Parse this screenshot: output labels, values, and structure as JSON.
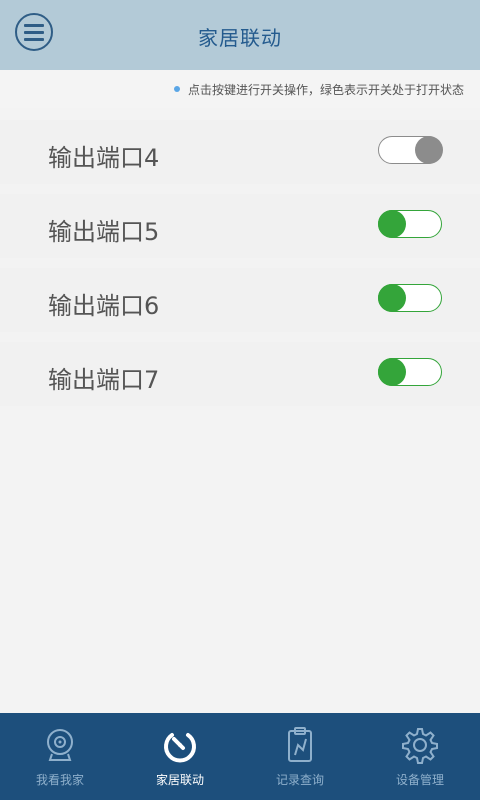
{
  "header": {
    "title": "家居联动",
    "menu_icon": "hamburger-menu-icon"
  },
  "hint": {
    "text": "点击按键进行开关操作，绿色表示开关处于打开状态",
    "dot_color": "#5aa6e6"
  },
  "ports": [
    {
      "label": "输出端口4",
      "on": false
    },
    {
      "label": "输出端口5",
      "on": true
    },
    {
      "label": "输出端口6",
      "on": true
    },
    {
      "label": "输出端口7",
      "on": true
    }
  ],
  "nav": {
    "items": [
      {
        "label": "我看我家",
        "icon": "camera-icon",
        "active": false
      },
      {
        "label": "家居联动",
        "icon": "linkage-icon",
        "active": true
      },
      {
        "label": "记录查询",
        "icon": "record-clipboard-icon",
        "active": false
      },
      {
        "label": "设备管理",
        "icon": "gear-icon",
        "active": false
      }
    ]
  },
  "colors": {
    "header_bg": "#b3cad7",
    "title": "#245b8e",
    "toggle_on": "#34a53a",
    "toggle_off": "#8c8c8c",
    "nav_bg": "#1d4f7c"
  }
}
